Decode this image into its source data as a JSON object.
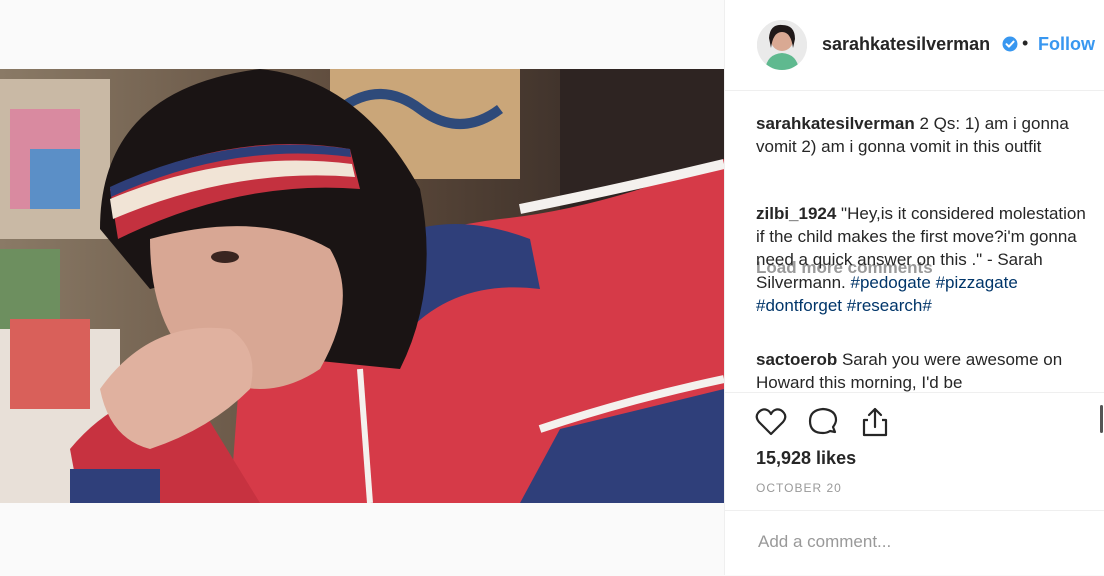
{
  "header": {
    "username": "sarahkatesilverman",
    "separator": "•",
    "follow_label": "Follow"
  },
  "caption": {
    "username": "sarahkatesilverman",
    "text": " 2 Qs: 1) am i gonna vomit 2) am i gonna vomit in this outfit"
  },
  "load_more": "Load more comments",
  "comments": [
    {
      "username": "zilbi_1924",
      "text": " \"Hey,is it considered molestation if the child makes the first move?i'm gonna need a quick answer on this .\" - Sarah Silvermann. ",
      "tags": "#pedogate #pizzagate #dontforget #research#"
    },
    {
      "username": "sactoerob",
      "text": " Sarah you were awesome on Howard this morning, I'd be"
    }
  ],
  "actions": {
    "like_icon": "heart-icon",
    "comment_icon": "comment-bubble-icon",
    "share_icon": "share-icon"
  },
  "likes": "15,928 likes",
  "date": "OCTOBER 20",
  "add_comment_placeholder": "Add a comment...",
  "colors": {
    "accent": "#3897f0",
    "verified": "#3897f0",
    "hashtag": "#003569",
    "muted": "#999999"
  }
}
